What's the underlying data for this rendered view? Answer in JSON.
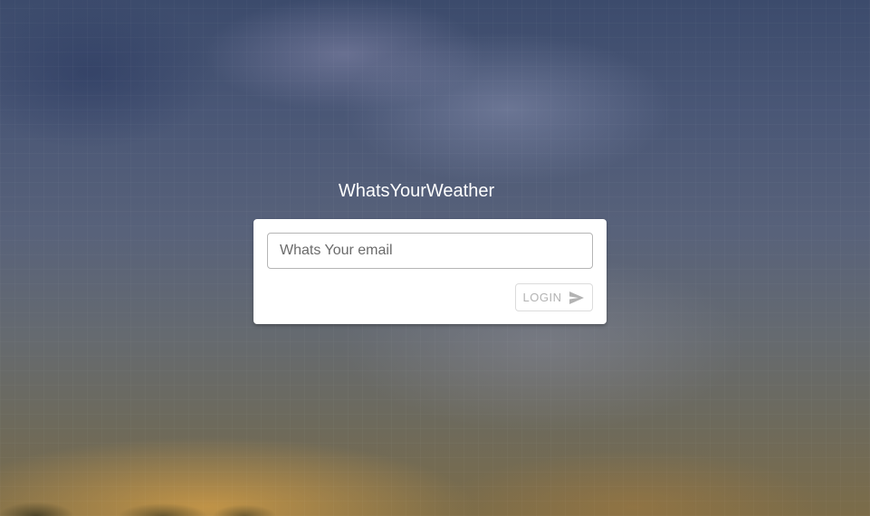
{
  "app": {
    "title": "WhatsYourWeather"
  },
  "login_form": {
    "email_placeholder": "Whats Your email",
    "email_value": "",
    "login_label": "LOGIN",
    "login_icon": "send-icon",
    "login_enabled": false
  },
  "colors": {
    "title_text": "#ffffff",
    "card_background": "#ffffff",
    "disabled_text": "#b3b3b3"
  }
}
